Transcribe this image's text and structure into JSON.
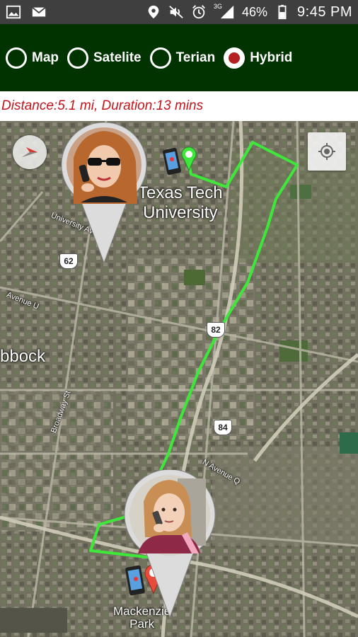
{
  "status_bar": {
    "left_icons": [
      "image-icon",
      "mail-icon"
    ],
    "right_icons": [
      "location-icon",
      "mute-icon",
      "alarm-icon",
      "signal-icon",
      "battery-icon"
    ],
    "network": "3G",
    "battery": "46%",
    "time": "9:45 PM"
  },
  "map_types": {
    "options": [
      {
        "label": "Map",
        "selected": false
      },
      {
        "label": "Satelite",
        "selected": false
      },
      {
        "label": "Terian",
        "selected": false
      },
      {
        "label": "Hybrid",
        "selected": true
      }
    ]
  },
  "route_info": "Distance:5.1 mi, Duration:13 mins",
  "map": {
    "labels": {
      "university_line1": "Texas Tech",
      "university_line2": "University",
      "city": "bbock",
      "park_line1": "Mackenzie",
      "park_line2": "Park",
      "university_ave": "University Ave",
      "avenue_u": "Avenue U",
      "broadway": "Broadway St",
      "n_avenue_q": "N Avenue Q"
    },
    "shields": [
      "62",
      "82",
      "84"
    ],
    "route_color": "#3ee83a",
    "controls": {
      "compass": "compass-icon",
      "my_location": "my-location-icon"
    },
    "pins": [
      {
        "name": "start-contact-pin",
        "marker": "green"
      },
      {
        "name": "end-contact-pin",
        "marker": "red"
      }
    ]
  }
}
